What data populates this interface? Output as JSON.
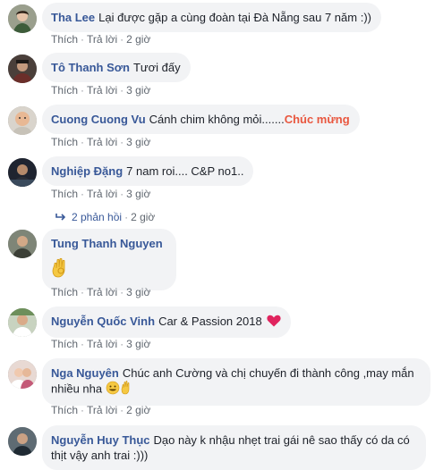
{
  "actions": {
    "like": "Thích",
    "reply": "Trả lời",
    "sep": "·"
  },
  "comments": [
    {
      "author": "Tha Lee",
      "text": "Lại được gặp a cùng đoàn tại Đà Nẵng sau 7 năm :))",
      "time": "2 giờ"
    },
    {
      "author": "Tô Thanh Sơn",
      "text": "Tươi đấy",
      "time": "3 giờ"
    },
    {
      "author": "Cuong Cuong Vu",
      "text": "Cánh chim không mỏi.......",
      "highlight": "Chúc mừng",
      "time": "3 giờ"
    },
    {
      "author": "Nghiệp Đặng",
      "text": "7 nam roi.... C&P no1..",
      "time": "3 giờ",
      "replies": "2 phản hồi",
      "replies_time": "2 giờ"
    },
    {
      "author": "Tung Thanh Nguyen",
      "text": "",
      "emoji": "ok-hand-emoji",
      "time": "3 giờ"
    },
    {
      "author": "Nguyễn Quốc Vinh",
      "text": "Car & Passion 2018",
      "emoji": "heart-emoji",
      "time": "3 giờ"
    },
    {
      "author": "Nga Nguyên",
      "text": "Chúc anh Cường và chị chuyến đi thành công ,may mắn nhiều nha",
      "emoji": "smile-ok-emoji",
      "time": "2 giờ"
    },
    {
      "author": "Nguyễn Huy Thục",
      "text": "Dạo này k nhậu nhẹt trai gái nê sao thấy có da có thịt vậy anh trai :)))"
    }
  ],
  "colors": {
    "author": "#385898",
    "bubble": "#f2f3f5",
    "meta": "#606770",
    "highlight": "#e9573f",
    "heart": "#e0245e"
  },
  "icons": {
    "reply_arrow": "reply-arrow-icon"
  }
}
